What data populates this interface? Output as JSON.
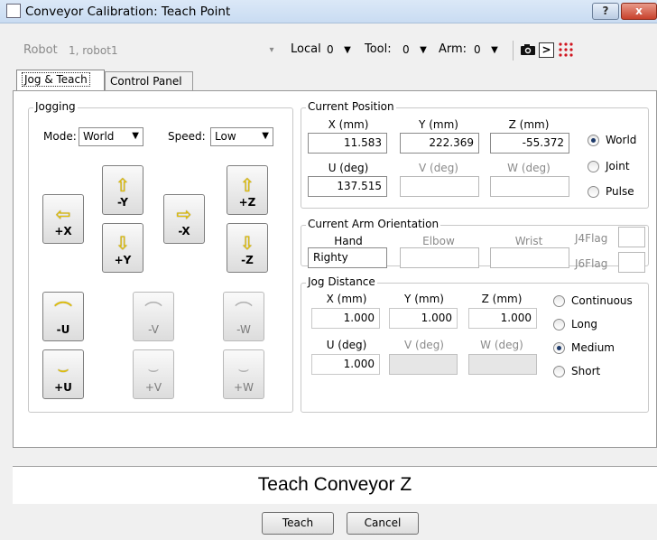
{
  "window": {
    "title": "Conveyor Calibration: Teach Point",
    "help_label": "?",
    "close_label": "x"
  },
  "robotbar": {
    "robot_label": "Robot",
    "robot_value": "1, robot1",
    "local_label": "Local",
    "local_value": "0",
    "tool_label": "Tool:",
    "tool_value": "0",
    "arm_label": "Arm:",
    "arm_value": "0"
  },
  "tabs": [
    {
      "label": "Jog & Teach",
      "active": true
    },
    {
      "label": "Control Panel",
      "active": false
    }
  ],
  "jogging": {
    "title": "Jogging",
    "mode_label": "Mode:",
    "mode_value": "World",
    "speed_label": "Speed:",
    "speed_value": "Low",
    "buttons": {
      "neg_y": "-Y",
      "pos_z": "+Z",
      "pos_x": "+X",
      "neg_x": "-X",
      "pos_y": "+Y",
      "neg_z": "-Z",
      "neg_u": "-U",
      "neg_v": "-V",
      "neg_w": "-W",
      "pos_u": "+U",
      "pos_v": "+V",
      "pos_w": "+W"
    }
  },
  "current_position": {
    "title": "Current Position",
    "headers": [
      "X (mm)",
      "Y (mm)",
      "Z (mm)",
      "U (deg)",
      "V (deg)",
      "W (deg)"
    ],
    "values": [
      "11.583",
      "222.369",
      "-55.372",
      "137.515",
      "",
      ""
    ],
    "radios": [
      "World",
      "Joint",
      "Pulse"
    ],
    "selected": "World"
  },
  "arm_orientation": {
    "title": "Current Arm Orientation",
    "headers": [
      "Hand",
      "Elbow",
      "Wrist"
    ],
    "values": [
      "Righty",
      "",
      ""
    ],
    "j4flag": "J4Flag",
    "j6flag": "J6Flag"
  },
  "jog_distance": {
    "title": "Jog Distance",
    "headers": [
      "X (mm)",
      "Y (mm)",
      "Z (mm)",
      "U (deg)",
      "V (deg)",
      "W (deg)"
    ],
    "values": [
      "1.000",
      "1.000",
      "1.000",
      "1.000",
      "",
      ""
    ],
    "radios": [
      "Continuous",
      "Long",
      "Medium",
      "Short"
    ],
    "selected": "Medium"
  },
  "banner": {
    "text": "Teach Conveyor Z"
  },
  "footer": {
    "teach_label": "Teach",
    "cancel_label": "Cancel"
  }
}
